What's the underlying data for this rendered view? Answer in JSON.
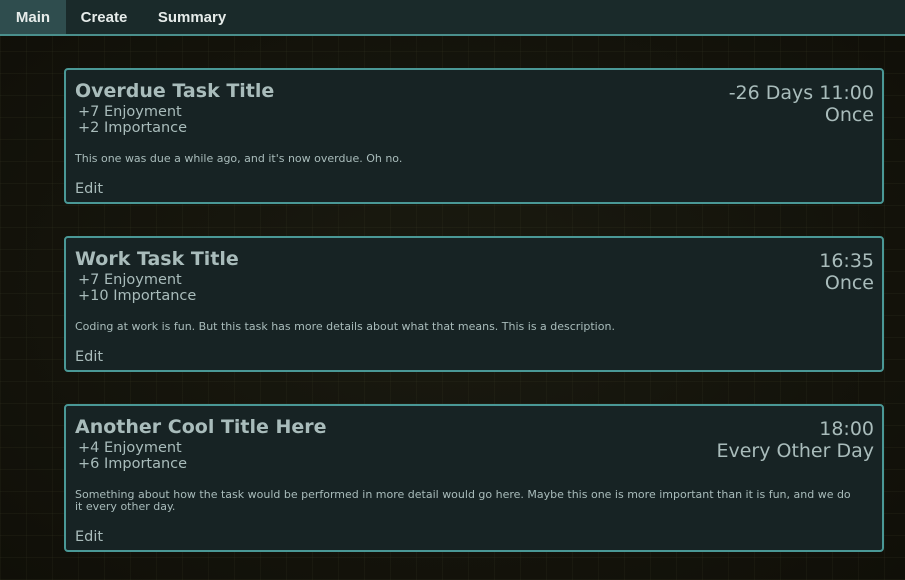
{
  "nav": {
    "tabs": [
      {
        "label": "Main",
        "active": true
      },
      {
        "label": "Create",
        "active": false
      },
      {
        "label": "Summary",
        "active": false
      }
    ]
  },
  "colors": {
    "accent": "#4a9896",
    "card_background": "#172324",
    "nav_background": "#1a2a2a",
    "active_tab": "#2f4d4e",
    "text": "#a9bcbb"
  },
  "tasks": [
    {
      "title": "Overdue Task Title",
      "enjoyment": "+7 Enjoyment",
      "importance": "+2 Importance",
      "due": "-26 Days 11:00",
      "frequency": "Once",
      "description": "This one was due a while ago, and it's now overdue. Oh no.",
      "edit_label": "Edit"
    },
    {
      "title": "Work Task Title",
      "enjoyment": "+7 Enjoyment",
      "importance": "+10 Importance",
      "due": "16:35",
      "frequency": "Once",
      "description": "Coding at work is fun. But this task has more details about what that means. This is a description.",
      "edit_label": "Edit"
    },
    {
      "title": "Another Cool Title Here",
      "enjoyment": "+4 Enjoyment",
      "importance": "+6 Importance",
      "due": "18:00",
      "frequency": "Every Other Day",
      "description": "Something about how the task would be performed in more detail would go here. Maybe this one is more important than it is fun, and we do it every other day.",
      "edit_label": "Edit"
    }
  ]
}
